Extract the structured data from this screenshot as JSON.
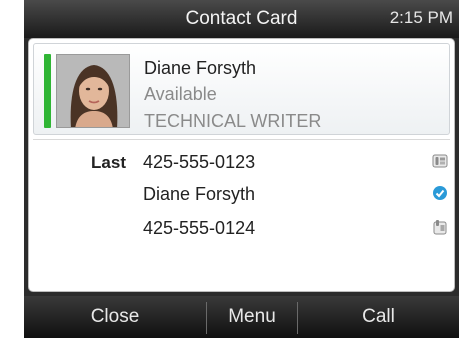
{
  "titlebar": {
    "title": "Contact Card",
    "time": "2:15 PM"
  },
  "contact": {
    "name": "Diane Forsyth",
    "status": "Available",
    "title": "TECHNICAL WRITER",
    "presence_color": "#2fb534"
  },
  "details": [
    {
      "label": "Last",
      "value": "425-555-0123",
      "icon": "work-phone-icon"
    },
    {
      "label": "",
      "value": "Diane Forsyth",
      "icon": "chat-icon"
    },
    {
      "label": "",
      "value": "425-555-0124",
      "icon": "mobile-phone-icon"
    }
  ],
  "softkeys": {
    "close": "Close",
    "menu": "Menu",
    "call": "Call"
  }
}
